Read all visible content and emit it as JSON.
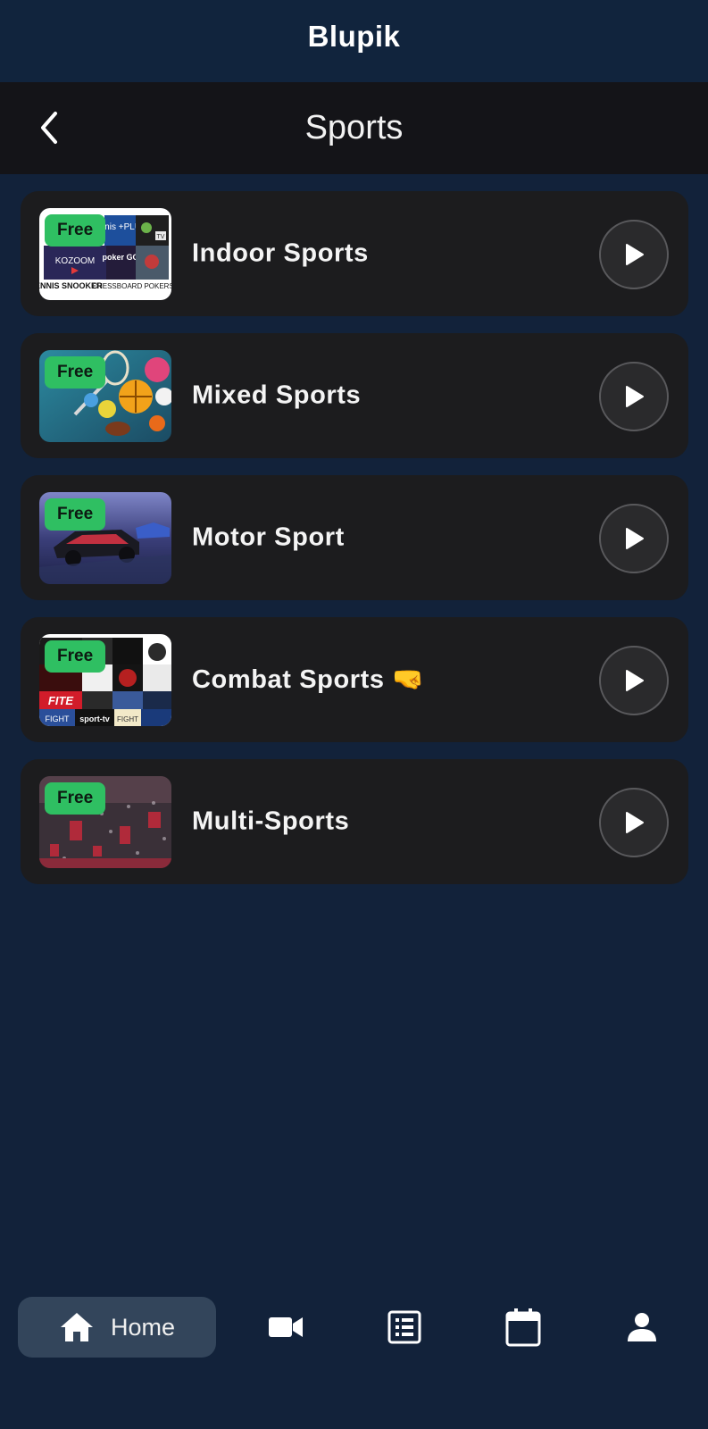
{
  "app": {
    "title": "Blupik"
  },
  "nav": {
    "title": "Sports",
    "back_icon": "chevron-left-icon"
  },
  "categories": [
    {
      "title": "Indoor Sports",
      "badge": "Free",
      "thumb_icon": "indoor-sports-collage-image",
      "thumb_texts": [
        "tennis +PLUS",
        "TV",
        "KOZOOM",
        "poker GO",
        "TENNIS SNOOKER",
        "CHESSBOARD POKERS"
      ]
    },
    {
      "title": "Mixed Sports",
      "badge": "Free",
      "thumb_icon": "mixed-sports-balls-image",
      "thumb_texts": []
    },
    {
      "title": "Motor Sport",
      "badge": "Free",
      "thumb_icon": "race-car-image",
      "thumb_texts": []
    },
    {
      "title": "Combat Sports 🤜",
      "badge": "Free",
      "thumb_icon": "combat-sports-collage-image",
      "thumb_texts": [
        "FITE",
        "FIGHT",
        "sport-tv",
        "FIGHT"
      ]
    },
    {
      "title": "Multi-Sports",
      "badge": "Free",
      "thumb_icon": "stadium-crowd-image",
      "thumb_texts": []
    }
  ],
  "tabbar": {
    "home_label": "Home",
    "icons": [
      "home-icon",
      "video-camera-icon",
      "list-icon",
      "calendar-icon",
      "person-icon"
    ]
  },
  "colors": {
    "background": "#12223a",
    "card": "#1c1c1e",
    "badge": "#2fbf62",
    "nav_bar": "#141418",
    "tab_active": "#33455b"
  }
}
